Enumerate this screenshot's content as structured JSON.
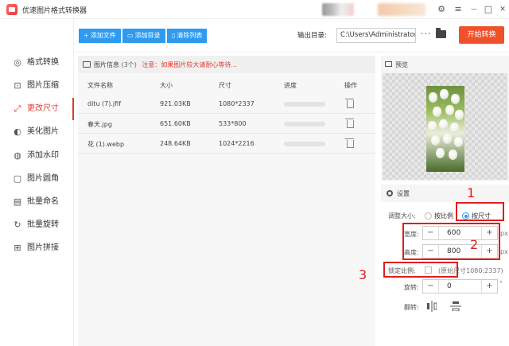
{
  "app": {
    "title": "优速图片格式转换器"
  },
  "window_controls": {
    "settings": "⚙",
    "menu": "≡",
    "minimize": "—",
    "maximize": "□",
    "close": "✕"
  },
  "sidebar": {
    "items": [
      {
        "label": "格式转换",
        "icon": "format-convert-icon",
        "glyph": "◎",
        "active": false
      },
      {
        "label": "图片压缩",
        "icon": "image-compress-icon",
        "glyph": "⊡",
        "active": false
      },
      {
        "label": "更改尺寸",
        "icon": "resize-icon",
        "glyph": "⤢",
        "active": true
      },
      {
        "label": "美化图片",
        "icon": "beautify-icon",
        "glyph": "◐",
        "active": false
      },
      {
        "label": "添加水印",
        "icon": "watermark-icon",
        "glyph": "◍",
        "active": false
      },
      {
        "label": "图片圆角",
        "icon": "round-corner-icon",
        "glyph": "▢",
        "active": false
      },
      {
        "label": "批量命名",
        "icon": "rename-icon",
        "glyph": "▤",
        "active": false
      },
      {
        "label": "批量旋转",
        "icon": "rotate-icon",
        "glyph": "↻",
        "active": false
      },
      {
        "label": "图片拼接",
        "icon": "stitch-icon",
        "glyph": "⊞",
        "active": false
      }
    ]
  },
  "toolbar": {
    "add_file": "添加文件",
    "add_folder": "添加目录",
    "clear_list": "清除列表",
    "output_label": "输出目录:",
    "output_path": "C:\\Users\\Administrator\\",
    "more": "···",
    "start": "开始转换"
  },
  "file_panel": {
    "title": "图片信息",
    "count": "(3个)",
    "note": "注意：如果图片较大请耐心等待...",
    "columns": {
      "name": "文件名称",
      "size": "大小",
      "dimensions": "尺寸",
      "progress": "进度",
      "action": "操作"
    },
    "rows": [
      {
        "name": "ditu (7).jfif",
        "size": "921.03KB",
        "dimensions": "1080*2337",
        "progress": 0
      },
      {
        "name": "春天.jpg",
        "size": "651.60KB",
        "dimensions": "533*800",
        "progress": 0
      },
      {
        "name": "花 (1).webp",
        "size": "248.64KB",
        "dimensions": "1024*2216",
        "progress": 0
      }
    ]
  },
  "preview": {
    "title": "预览"
  },
  "settings": {
    "title": "设置",
    "adjust_label": "调整大小:",
    "option_ratio": "按比例",
    "option_size": "按尺寸",
    "selected": "按尺寸",
    "width_label": "宽度:",
    "width_value": "600",
    "height_label": "高度:",
    "height_value": "800",
    "unit": "px",
    "lock_label": "锁定比例:",
    "lock_checked": false,
    "original_size": "(原始尺寸1080:2337)",
    "rotate_label": "旋转:",
    "rotate_value": "0",
    "rotate_unit": "°",
    "flip_label": "翻转:",
    "minus": "−",
    "plus": "+"
  },
  "annotations": {
    "n1": "1",
    "n2": "2",
    "n3": "3",
    "color": "#e21c1c"
  }
}
